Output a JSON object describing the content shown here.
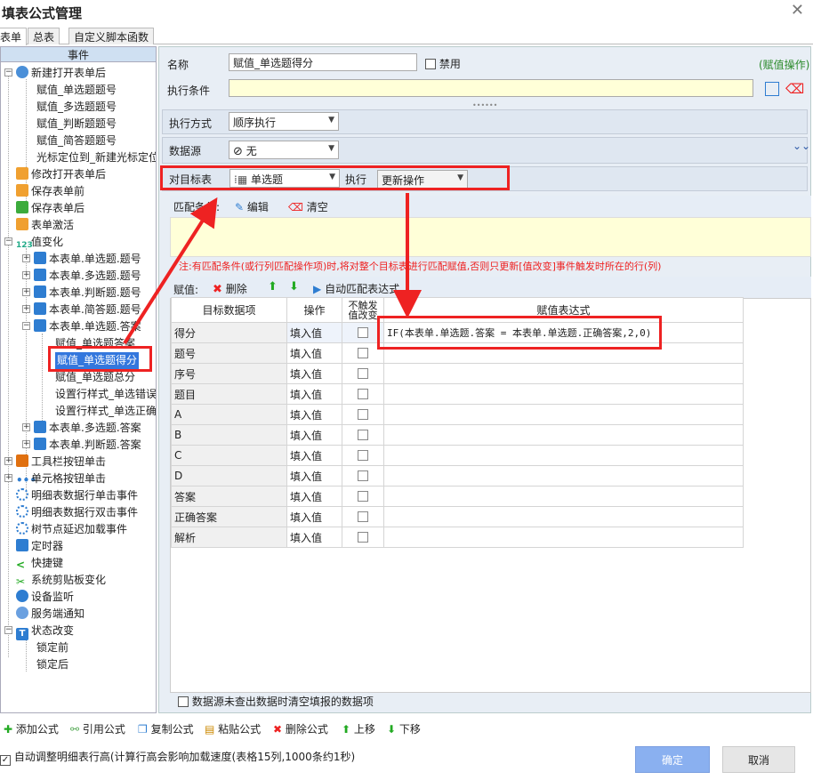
{
  "window": {
    "title": "填表公式管理",
    "close": "✕"
  },
  "tabs": [
    "表单",
    "总表",
    "自定义脚本函数"
  ],
  "left": {
    "header": "事件",
    "items": [
      {
        "label": "新建打开表单后"
      },
      {
        "label": "赋值_单选题题号"
      },
      {
        "label": "赋值_多选题题号"
      },
      {
        "label": "赋值_判断题题号"
      },
      {
        "label": "赋值_简答题题号"
      },
      {
        "label": "光标定位到_新建光标定位"
      },
      {
        "label": "修改打开表单后"
      },
      {
        "label": "保存表单前"
      },
      {
        "label": "保存表单后"
      },
      {
        "label": "表单激活"
      },
      {
        "label": "值变化"
      },
      {
        "label": "本表单.单选题.题号"
      },
      {
        "label": "本表单.多选题.题号"
      },
      {
        "label": "本表单.判断题.题号"
      },
      {
        "label": "本表单.简答题.题号"
      },
      {
        "label": "本表单.单选题.答案"
      },
      {
        "label": "赋值_单选题答案"
      },
      {
        "label": "赋值_单选题得分"
      },
      {
        "label": "赋值_单选题总分"
      },
      {
        "label": "设置行样式_单选错误"
      },
      {
        "label": "设置行样式_单选正确"
      },
      {
        "label": "本表单.多选题.答案"
      },
      {
        "label": "本表单.判断题.答案"
      },
      {
        "label": "工具栏按钮单击"
      },
      {
        "label": "单元格按钮单击"
      },
      {
        "label": "明细表数据行单击事件"
      },
      {
        "label": "明细表数据行双击事件"
      },
      {
        "label": "树节点延迟加载事件"
      },
      {
        "label": "定时器"
      },
      {
        "label": "快捷键"
      },
      {
        "label": "系统剪贴板变化"
      },
      {
        "label": "设备监听"
      },
      {
        "label": "服务端通知"
      },
      {
        "label": "状态改变"
      },
      {
        "label": "锁定前"
      },
      {
        "label": "锁定后"
      }
    ]
  },
  "form": {
    "name_label": "名称",
    "name_value": "赋值_单选题得分",
    "disable_label": "禁用",
    "type_tag": "(赋值操作)",
    "cond_label": "执行条件",
    "cond_value": "",
    "mode_label": "执行方式",
    "mode_value": "顺序执行",
    "src_label": "数据源",
    "src_value": "无",
    "target_label": "对目标表",
    "target_value": "单选题",
    "exec_label": "执行",
    "exec_value": "更新操作",
    "match_label": "匹配条件:",
    "edit_label": "编辑",
    "clear_label": "清空",
    "note": "注:有匹配条件(或行列匹配操作项)时,将对整个目标表进行匹配赋值,否则只更新[值改变]事件触发时所在的行(列)",
    "assign_label": "赋值:",
    "delete_label": "删除",
    "auto_label": "自动匹配表达式",
    "footer_check": "数据源未查出数据时清空填报的数据项"
  },
  "grid": {
    "headers": [
      "目标数据项",
      "操作",
      "不触发值改变",
      "赋值表达式"
    ],
    "rows": [
      {
        "item": "得分",
        "op": "填入值",
        "expr": "IF(本表单.单选题.答案 = 本表单.单选题.正确答案,2,0)"
      },
      {
        "item": "题号",
        "op": "填入值",
        "expr": ""
      },
      {
        "item": "序号",
        "op": "填入值",
        "expr": ""
      },
      {
        "item": "题目",
        "op": "填入值",
        "expr": ""
      },
      {
        "item": "A",
        "op": "填入值",
        "expr": ""
      },
      {
        "item": "B",
        "op": "填入值",
        "expr": ""
      },
      {
        "item": "C",
        "op": "填入值",
        "expr": ""
      },
      {
        "item": "D",
        "op": "填入值",
        "expr": ""
      },
      {
        "item": "答案",
        "op": "填入值",
        "expr": ""
      },
      {
        "item": "正确答案",
        "op": "填入值",
        "expr": ""
      },
      {
        "item": "解析",
        "op": "填入值",
        "expr": ""
      }
    ]
  },
  "toolbar": {
    "add": "添加公式",
    "ref": "引用公式",
    "copy": "复制公式",
    "paste": "粘贴公式",
    "del": "删除公式",
    "up": "上移",
    "down": "下移"
  },
  "bottom": {
    "auto_label": "自动调整明细表行高(计算行高会影响加载速度(表格15列,1000条约1秒)",
    "ok": "确定",
    "cancel": "取消"
  },
  "colors": {
    "accent": "#8ab0f0",
    "highlight": "#e22222"
  }
}
